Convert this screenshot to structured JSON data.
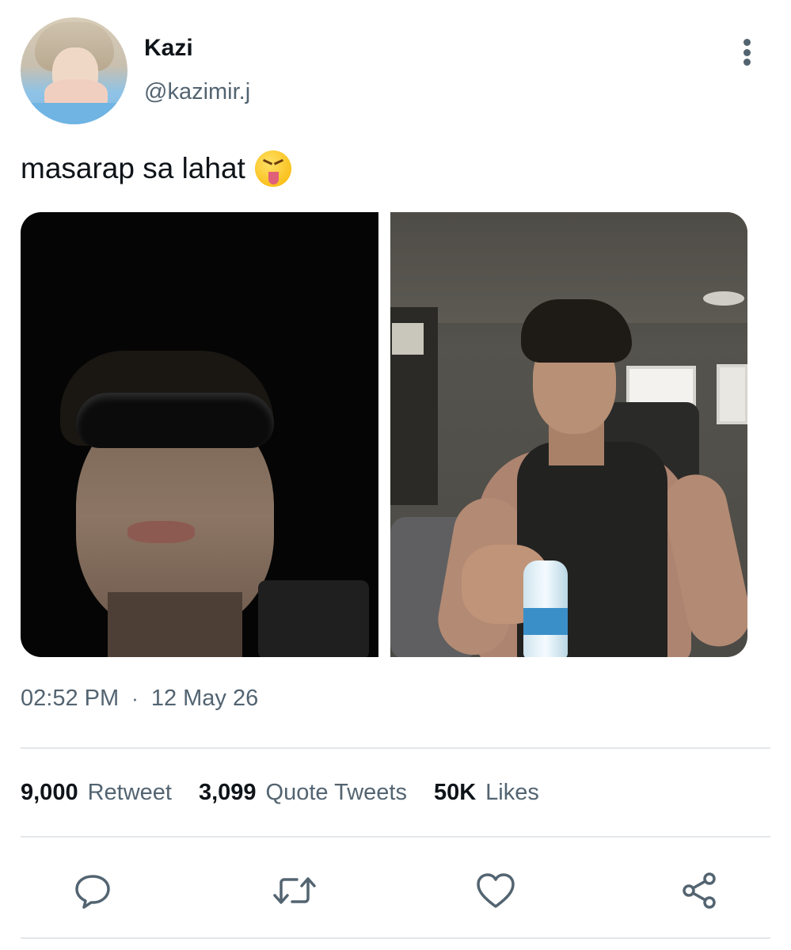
{
  "tweet": {
    "author": {
      "name": "Kazi",
      "handle": "@kazimir.j"
    },
    "text": "masarap sa lahat",
    "emoji": "squinting-face-with-tongue",
    "media_count": 2,
    "time": "02:52 PM",
    "separator": "·",
    "date": "12 May 26"
  },
  "stats": {
    "retweets": {
      "count": "9,000",
      "label": "Retweet"
    },
    "quotes": {
      "count": "3,099",
      "label": "Quote Tweets"
    },
    "likes": {
      "count": "50K",
      "label": "Likes"
    }
  },
  "icons": {
    "more": "more-vertical-icon",
    "reply": "reply-icon",
    "retweet": "retweet-icon",
    "like": "heart-icon",
    "share": "share-icon"
  },
  "colors": {
    "text_primary": "#0f1419",
    "text_secondary": "#536471",
    "divider": "#e4e7ea"
  }
}
